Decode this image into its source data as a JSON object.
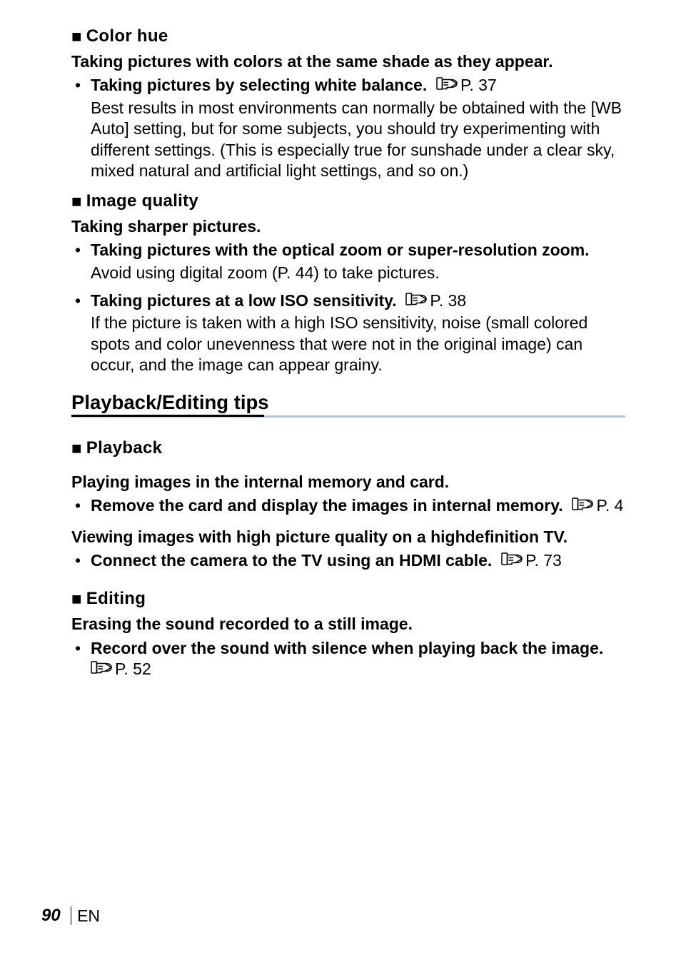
{
  "sections": {
    "colorHue": {
      "heading": "Color hue",
      "para1": "Taking pictures with colors at the same shade as they appear.",
      "b1Title": "Taking pictures by selecting white balance.",
      "b1Ref": " P. 37",
      "b1Body": "Best results in most environments can normally be obtained with the [WB Auto] setting, but for some subjects, you should try experimenting with different settings. (This is especially true for sunshade under a clear sky, mixed natural and artificial light settings, and so on.)"
    },
    "imageQuality": {
      "heading": "Image quality",
      "para1": "Taking sharper pictures.",
      "b1Title": "Taking pictures with the optical zoom or super-resolution zoom.",
      "b1Body": "Avoid using digital zoom (P. 44) to take pictures.",
      "b2Title": "Taking pictures at a low ISO sensitivity.",
      "b2Ref": " P. 38",
      "b2Body": "If the picture is taken with a high ISO sensitivity, noise (small colored spots and color unevenness that were not in the original image) can occur, and the image can appear grainy."
    },
    "playbackEditing": {
      "title": "Playback/Editing tips",
      "playback": {
        "heading": "Playback",
        "para1": "Playing images in the internal memory and card.",
        "b1Title": "Remove the card and display the images in internal memory.",
        "b1Ref": " P. 4",
        "para2": "Viewing images with high picture quality on a highdefinition TV.",
        "b2Title": "Connect the camera to the TV using an HDMI cable.",
        "b2Ref": " P. 73"
      },
      "editing": {
        "heading": "Editing",
        "para1": "Erasing the sound recorded to a still image.",
        "b1Title": "Record over the sound with silence when playing back the image.",
        "b1Ref": " P. 52"
      }
    }
  },
  "footer": {
    "pageNumber": "90",
    "lang": "EN"
  },
  "glyphs": {
    "square": "■"
  }
}
